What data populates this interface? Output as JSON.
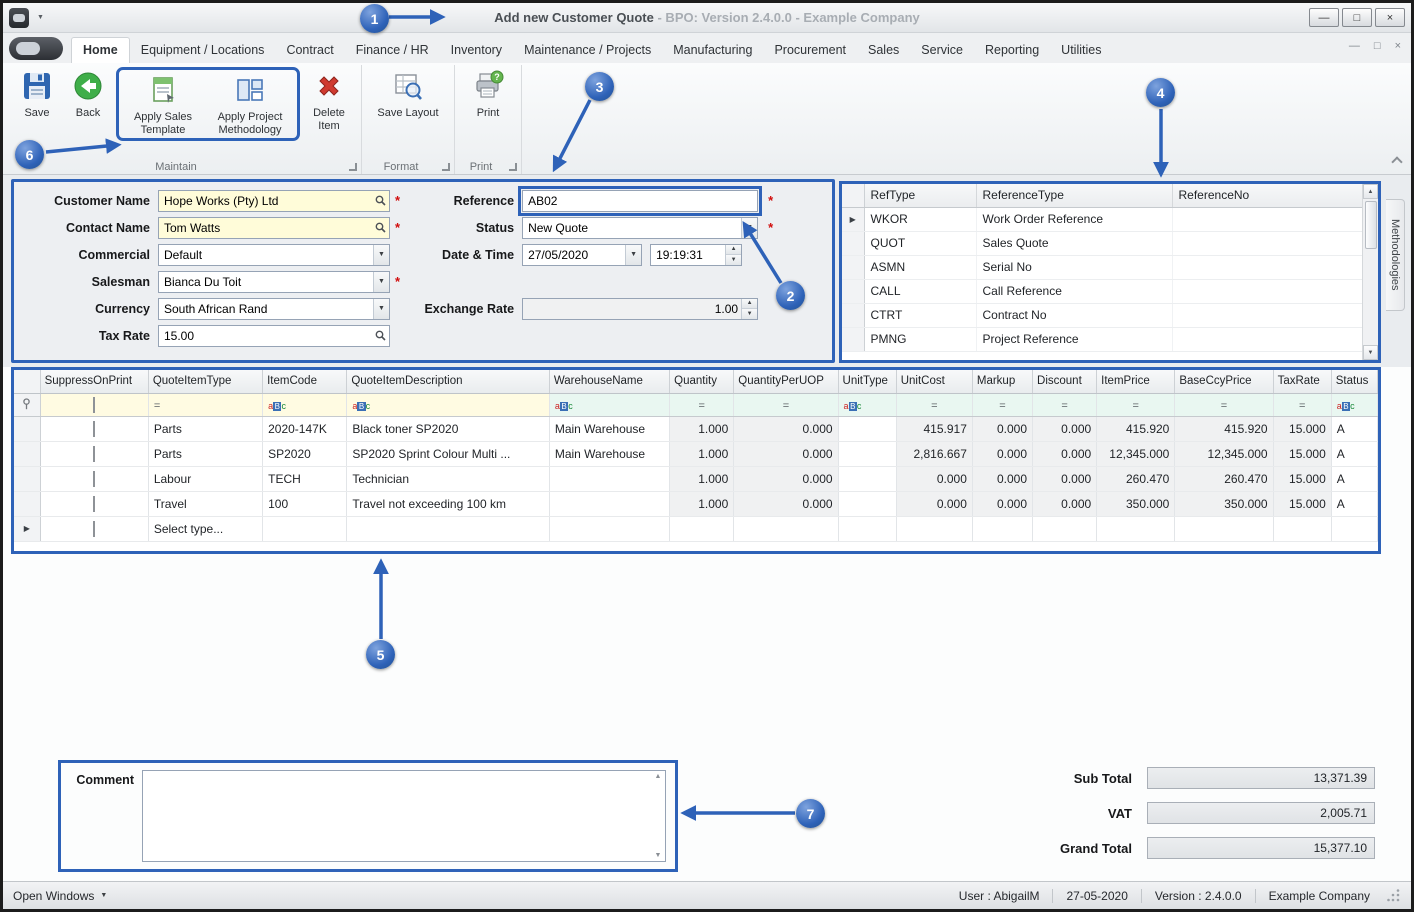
{
  "titlebar": {
    "title_main": "Add new Customer Quote",
    "title_rest": " - BPO: Version 2.4.0.0 - Example Company"
  },
  "icons": {
    "dropdown": "▼",
    "spin_up": "▲",
    "spin_down": "▼",
    "row_arrow": "▶",
    "minimize": "—",
    "maximize": "□",
    "close": "×",
    "equals": "=",
    "abc_a": "a",
    "abc_b": "B",
    "abc_c": "c",
    "asterisk": "*",
    "scroll_up": "▲",
    "scroll_down": "▼"
  },
  "ribbon": {
    "tabs": [
      "Home",
      "Equipment / Locations",
      "Contract",
      "Finance / HR",
      "Inventory",
      "Maintenance / Projects",
      "Manufacturing",
      "Procurement",
      "Sales",
      "Service",
      "Reporting",
      "Utilities"
    ],
    "buttons": {
      "save": "Save",
      "back": "Back",
      "apply_sales": "Apply Sales Template",
      "apply_project": "Apply Project Methodology",
      "delete_item": "Delete Item",
      "save_layout": "Save Layout",
      "print": "Print"
    },
    "groups": {
      "maintain": "Maintain",
      "format": "Format",
      "print": "Print"
    }
  },
  "form": {
    "customer_name": {
      "label": "Customer Name",
      "value": "Hope Works (Pty) Ltd"
    },
    "contact_name": {
      "label": "Contact Name",
      "value": "Tom Watts"
    },
    "commercial": {
      "label": "Commercial",
      "value": "Default"
    },
    "salesman": {
      "label": "Salesman",
      "value": "Bianca Du Toit"
    },
    "currency": {
      "label": "Currency",
      "value": "South African Rand"
    },
    "tax_rate": {
      "label": "Tax Rate",
      "value": "15.00"
    },
    "reference": {
      "label": "Reference",
      "value": "AB02"
    },
    "status": {
      "label": "Status",
      "value": "New Quote"
    },
    "date_time": {
      "label": "Date & Time",
      "date": "27/05/2020",
      "time": "19:19:31"
    },
    "exchange_rate": {
      "label": "Exchange Rate",
      "value": "1.00"
    }
  },
  "ref_panel": {
    "columns": [
      "RefType",
      "ReferenceType",
      "ReferenceNo"
    ],
    "rows": [
      {
        "ref_type": "WKOR",
        "reference_type": "Work Order Reference",
        "reference_no": ""
      },
      {
        "ref_type": "QUOT",
        "reference_type": "Sales Quote",
        "reference_no": ""
      },
      {
        "ref_type": "ASMN",
        "reference_type": "Serial No",
        "reference_no": ""
      },
      {
        "ref_type": "CALL",
        "reference_type": "Call Reference",
        "reference_no": ""
      },
      {
        "ref_type": "CTRT",
        "reference_type": "Contract No",
        "reference_no": ""
      },
      {
        "ref_type": "PMNG",
        "reference_type": "Project Reference",
        "reference_no": ""
      }
    ],
    "side_tab": "Methodologies"
  },
  "grid": {
    "columns": [
      "SuppressOnPrint",
      "QuoteItemType",
      "ItemCode",
      "QuoteItemDescription",
      "WarehouseName",
      "Quantity",
      "QuantityPerUOP",
      "UnitType",
      "UnitCost",
      "Markup",
      "Discount",
      "ItemPrice",
      "BaseCcyPrice",
      "TaxRate",
      "Status"
    ],
    "rows": [
      {
        "quote_item_type": "Parts",
        "item_code": "2020-147K",
        "description": "Black toner SP2020",
        "warehouse": "Main Warehouse",
        "quantity": "1.000",
        "quantity_per_uop": "0.000",
        "unit_type": "",
        "unit_cost": "415.917",
        "markup": "0.000",
        "discount": "0.000",
        "item_price": "415.920",
        "base_ccy_price": "415.920",
        "tax_rate": "15.000",
        "status": "A"
      },
      {
        "quote_item_type": "Parts",
        "item_code": "SP2020",
        "description": "SP2020 Sprint Colour Multi ...",
        "warehouse": "Main Warehouse",
        "quantity": "1.000",
        "quantity_per_uop": "0.000",
        "unit_type": "",
        "unit_cost": "2,816.667",
        "markup": "0.000",
        "discount": "0.000",
        "item_price": "12,345.000",
        "base_ccy_price": "12,345.000",
        "tax_rate": "15.000",
        "status": "A"
      },
      {
        "quote_item_type": "Labour",
        "item_code": "TECH",
        "description": "Technician",
        "warehouse": "",
        "quantity": "1.000",
        "quantity_per_uop": "0.000",
        "unit_type": "",
        "unit_cost": "0.000",
        "markup": "0.000",
        "discount": "0.000",
        "item_price": "260.470",
        "base_ccy_price": "260.470",
        "tax_rate": "15.000",
        "status": "A"
      },
      {
        "quote_item_type": "Travel",
        "item_code": "100",
        "description": "Travel not exceeding 100 km",
        "warehouse": "",
        "quantity": "1.000",
        "quantity_per_uop": "0.000",
        "unit_type": "",
        "unit_cost": "0.000",
        "markup": "0.000",
        "discount": "0.000",
        "item_price": "350.000",
        "base_ccy_price": "350.000",
        "tax_rate": "15.000",
        "status": "A"
      }
    ],
    "new_row_label": "Select type..."
  },
  "comment": {
    "label": "Comment",
    "value": ""
  },
  "totals": {
    "sub_total": {
      "label": "Sub Total",
      "value": "13,371.39"
    },
    "vat": {
      "label": "VAT",
      "value": "2,005.71"
    },
    "grand_total": {
      "label": "Grand Total",
      "value": "15,377.10"
    }
  },
  "statusbar": {
    "open_windows": "Open Windows",
    "user": "User : AbigailM",
    "date": "27-05-2020",
    "version": "Version : 2.4.0.0",
    "company": "Example Company"
  },
  "callouts": [
    "1",
    "2",
    "3",
    "4",
    "5",
    "6",
    "7"
  ],
  "colors": {
    "annotation_blue": "#2e62b8",
    "required_red": "#d10d0d",
    "lookup_field_yellow": "#fffcd9",
    "filter_yellow": "#fffbe2",
    "filter_green": "#e9f7f1"
  }
}
